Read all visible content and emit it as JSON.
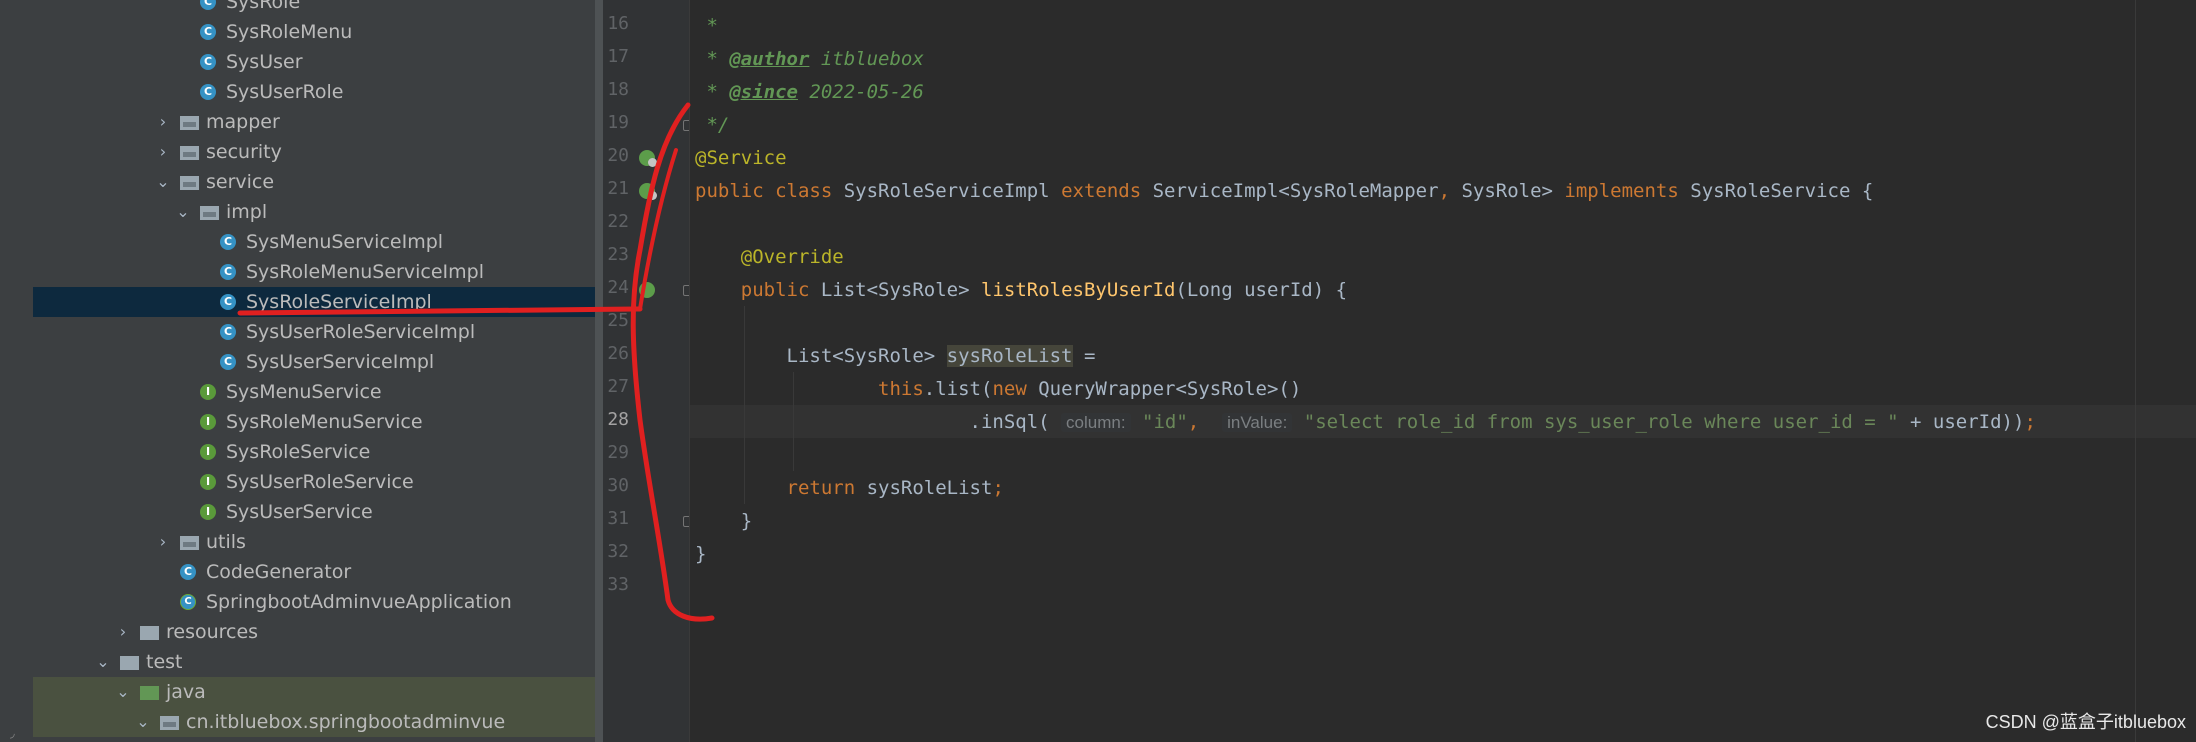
{
  "tree": [
    {
      "label": "SysRole",
      "icon": "class-icon",
      "glyph": "C",
      "indent": 2,
      "chev": ""
    },
    {
      "label": "SysRoleMenu",
      "icon": "class-icon",
      "glyph": "C",
      "indent": 2,
      "chev": ""
    },
    {
      "label": "SysUser",
      "icon": "class-icon",
      "glyph": "C",
      "indent": 2,
      "chev": ""
    },
    {
      "label": "SysUserRole",
      "icon": "class-icon",
      "glyph": "C",
      "indent": 2,
      "chev": ""
    },
    {
      "label": "mapper",
      "icon": "package-icon",
      "indent": 1,
      "chev": "right"
    },
    {
      "label": "security",
      "icon": "package-icon",
      "indent": 1,
      "chev": "right"
    },
    {
      "label": "service",
      "icon": "package-icon",
      "indent": 1,
      "chev": "down"
    },
    {
      "label": "impl",
      "icon": "package-icon",
      "indent": 2,
      "chev": "down"
    },
    {
      "label": "SysMenuServiceImpl",
      "icon": "class-icon",
      "glyph": "C",
      "indent": 3,
      "chev": ""
    },
    {
      "label": "SysRoleMenuServiceImpl",
      "icon": "class-icon",
      "glyph": "C",
      "indent": 3,
      "chev": ""
    },
    {
      "label": "SysRoleServiceImpl",
      "icon": "class-icon",
      "glyph": "C",
      "indent": 3,
      "chev": "",
      "selected": true
    },
    {
      "label": "SysUserRoleServiceImpl",
      "icon": "class-icon",
      "glyph": "C",
      "indent": 3,
      "chev": ""
    },
    {
      "label": "SysUserServiceImpl",
      "icon": "class-icon",
      "glyph": "C",
      "indent": 3,
      "chev": ""
    },
    {
      "label": "SysMenuService",
      "icon": "interface-icon",
      "glyph": "I",
      "indent": 2,
      "chev": ""
    },
    {
      "label": "SysRoleMenuService",
      "icon": "interface-icon",
      "glyph": "I",
      "indent": 2,
      "chev": ""
    },
    {
      "label": "SysRoleService",
      "icon": "interface-icon",
      "glyph": "I",
      "indent": 2,
      "chev": ""
    },
    {
      "label": "SysUserRoleService",
      "icon": "interface-icon",
      "glyph": "I",
      "indent": 2,
      "chev": ""
    },
    {
      "label": "SysUserService",
      "icon": "interface-icon",
      "glyph": "I",
      "indent": 2,
      "chev": ""
    },
    {
      "label": "utils",
      "icon": "package-icon",
      "indent": 1,
      "chev": "right"
    },
    {
      "label": "CodeGenerator",
      "icon": "class-icon",
      "glyph": "C",
      "indent": 1,
      "chev": ""
    },
    {
      "label": "SpringbootAdminvueApplication",
      "icon": "spring-boot-class-icon",
      "glyph": "C",
      "indent": 1,
      "chev": ""
    },
    {
      "label": "resources",
      "icon": "resources-folder-icon",
      "indent": -1,
      "chev": "right"
    },
    {
      "label": "test",
      "icon": "folder-icon",
      "indent": -2,
      "chev": "down"
    },
    {
      "label": "java",
      "icon": "test-source-folder-icon",
      "indent": -1,
      "chev": "down",
      "highlight": true
    },
    {
      "label": "cn.itbluebox.springbootadminvue",
      "icon": "package-icon",
      "indent": 0,
      "chev": "down",
      "highlight": true
    }
  ],
  "editor": {
    "current_line": 28,
    "lines": [
      {
        "n": "16",
        "tokens": [
          {
            "t": " *",
            "c": "doc"
          }
        ]
      },
      {
        "n": "17",
        "tokens": [
          {
            "t": " * ",
            "c": "doc"
          },
          {
            "t": "@author",
            "c": "tag"
          },
          {
            "t": " itbluebox",
            "c": "doc"
          }
        ]
      },
      {
        "n": "18",
        "tokens": [
          {
            "t": " * ",
            "c": "doc"
          },
          {
            "t": "@since",
            "c": "tag"
          },
          {
            "t": " 2022-05-26",
            "c": "doc"
          }
        ]
      },
      {
        "n": "19",
        "tokens": [
          {
            "t": " */",
            "c": "doc"
          }
        ]
      },
      {
        "n": "20",
        "tokens": [
          {
            "t": "@Service",
            "c": "ann"
          }
        ]
      },
      {
        "n": "21",
        "tokens": [
          {
            "t": "public class ",
            "c": "kw"
          },
          {
            "t": "SysRoleServiceImpl ",
            "c": ""
          },
          {
            "t": "extends ",
            "c": "kw"
          },
          {
            "t": "ServiceImpl<SysRoleMapper",
            "c": ""
          },
          {
            "t": ", ",
            "c": "kw"
          },
          {
            "t": "SysRole> ",
            "c": ""
          },
          {
            "t": "implements ",
            "c": "kw"
          },
          {
            "t": "SysRoleService {",
            "c": ""
          }
        ]
      },
      {
        "n": "22",
        "tokens": []
      },
      {
        "n": "23",
        "tokens": [
          {
            "t": "    ",
            "c": ""
          },
          {
            "t": "@Override",
            "c": "ann"
          }
        ]
      },
      {
        "n": "24",
        "tokens": [
          {
            "t": "    ",
            "c": ""
          },
          {
            "t": "public ",
            "c": "kw"
          },
          {
            "t": "List<SysRole> ",
            "c": ""
          },
          {
            "t": "listRolesByUserId",
            "c": "fn"
          },
          {
            "t": "(Long userId) {",
            "c": ""
          }
        ]
      },
      {
        "n": "25",
        "tokens": []
      },
      {
        "n": "26",
        "tokens": [
          {
            "t": "        List<SysRole> ",
            "c": ""
          },
          {
            "t": "sysRoleList",
            "c": "hl"
          },
          {
            "t": " =",
            "c": ""
          }
        ]
      },
      {
        "n": "27",
        "tokens": [
          {
            "t": "                ",
            "c": ""
          },
          {
            "t": "this",
            "c": "kw"
          },
          {
            "t": ".list(",
            "c": ""
          },
          {
            "t": "new ",
            "c": "kw"
          },
          {
            "t": "QueryWrapper<SysRole>()",
            "c": ""
          }
        ]
      },
      {
        "n": "28",
        "tokens": [
          {
            "t": "                        .inSql( ",
            "c": ""
          },
          {
            "t": "column:",
            "c": "hint"
          },
          {
            "t": " ",
            "c": ""
          },
          {
            "t": "\"id\"",
            "c": "str"
          },
          {
            "t": ",  ",
            "c": "kw"
          },
          {
            "t": "inValue:",
            "c": "hint"
          },
          {
            "t": " ",
            "c": ""
          },
          {
            "t": "\"select role_id from sys_user_role where user_id = \"",
            "c": "str"
          },
          {
            "t": " + userId))",
            "c": ""
          },
          {
            "t": ";",
            "c": "kw"
          }
        ]
      },
      {
        "n": "29",
        "tokens": []
      },
      {
        "n": "30",
        "tokens": [
          {
            "t": "        ",
            "c": ""
          },
          {
            "t": "return ",
            "c": "kw"
          },
          {
            "t": "sysRoleList",
            "c": ""
          },
          {
            "t": ";",
            "c": "kw"
          }
        ]
      },
      {
        "n": "31",
        "tokens": [
          {
            "t": "    }",
            "c": ""
          }
        ]
      },
      {
        "n": "32",
        "tokens": [
          {
            "t": "}",
            "c": ""
          }
        ]
      },
      {
        "n": "33",
        "tokens": []
      }
    ]
  },
  "watermark": "CSDN @蓝盒子itbluebox",
  "colors": {
    "keyword": "#cc7832",
    "annotation": "#bbb529",
    "doc": "#629755",
    "function": "#ffc66d",
    "string": "#6a8759",
    "text": "#a9b7c6",
    "ink": "#e02020"
  }
}
